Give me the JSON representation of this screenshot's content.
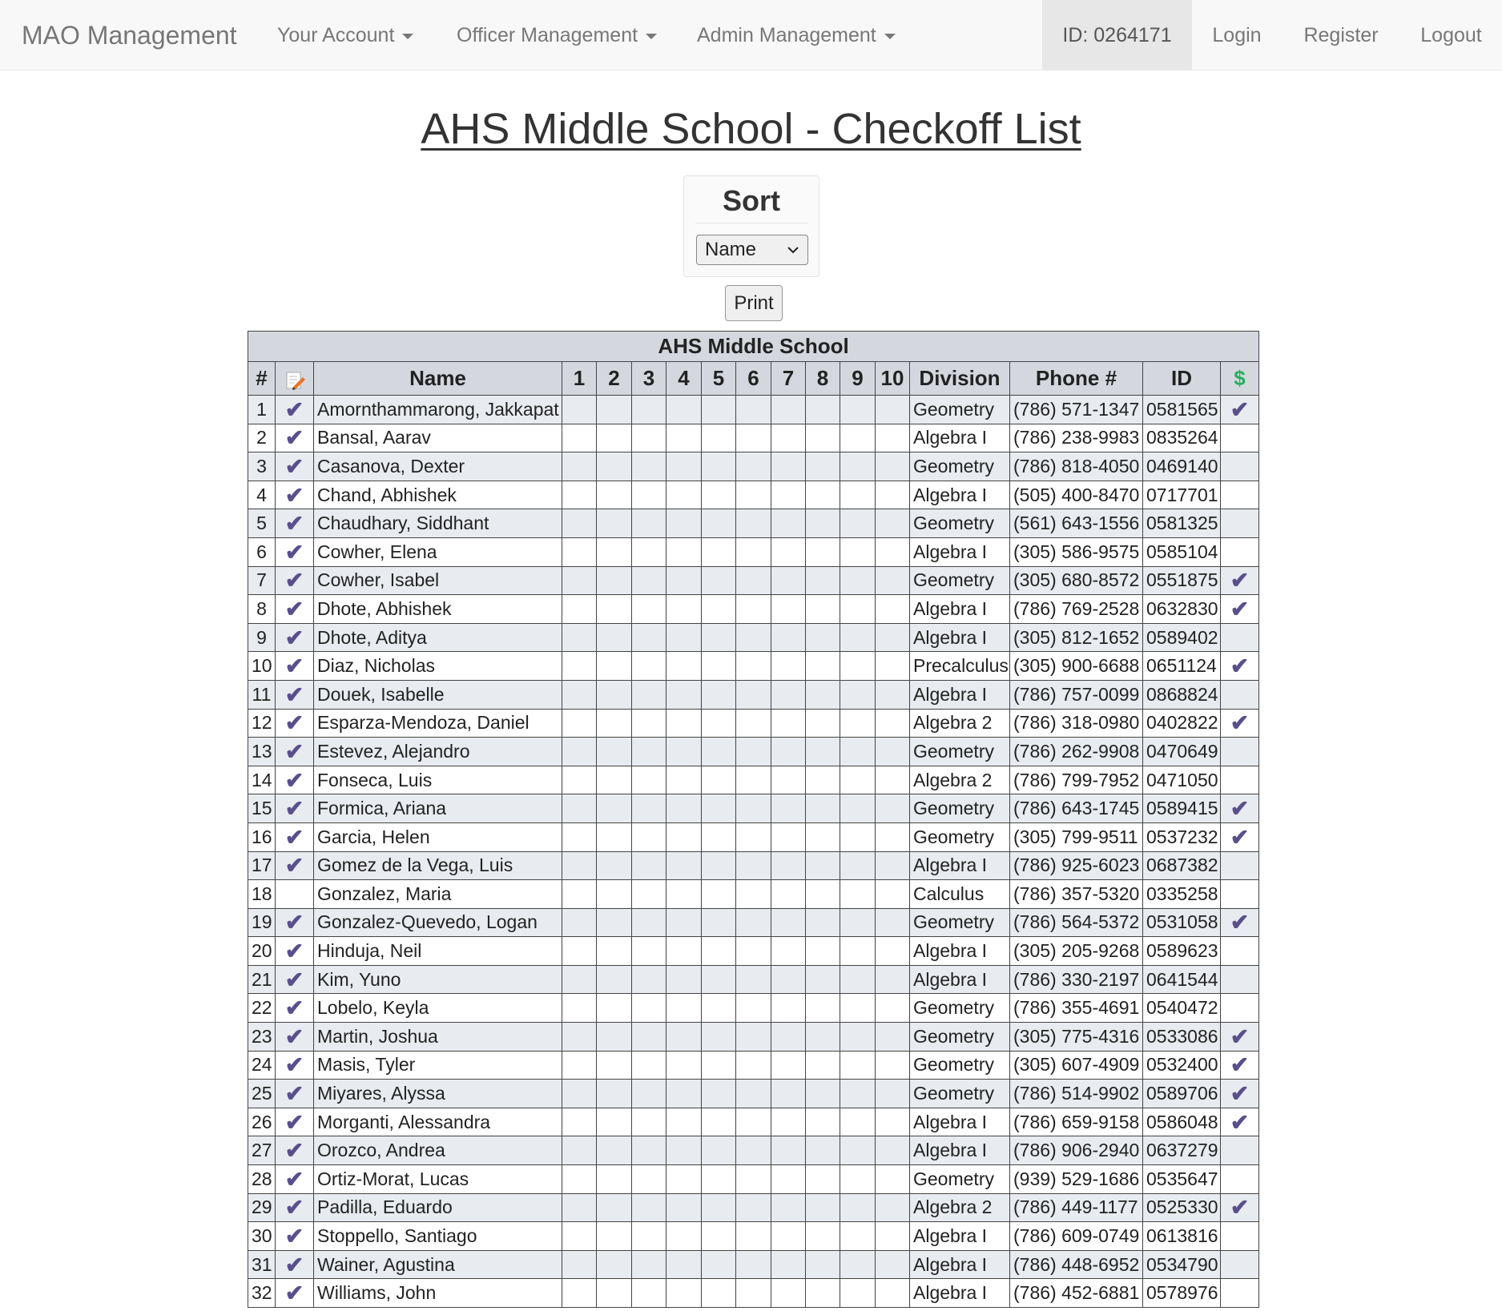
{
  "navbar": {
    "brand": "MAO Management",
    "menus": [
      "Your Account",
      "Officer Management",
      "Admin Management"
    ],
    "user_id": "ID: 0264171",
    "login": "Login",
    "register": "Register",
    "logout": "Logout"
  },
  "page": {
    "title": "AHS Middle School - Checkoff List"
  },
  "sort": {
    "title": "Sort",
    "selected": "Name"
  },
  "print_label": "Print",
  "table": {
    "caption": "AHS Middle School",
    "headers": [
      "#",
      "",
      "Name",
      "1",
      "2",
      "3",
      "4",
      "5",
      "6",
      "7",
      "8",
      "9",
      "10",
      "Division",
      "Phone #",
      "ID",
      "$"
    ],
    "checkmark": "✔",
    "rows": [
      {
        "num": "1",
        "checked": true,
        "name": "Amornthammarong, Jakkapat",
        "division": "Geometry",
        "phone": "(786) 571-1347",
        "id": "0581565",
        "paid": true
      },
      {
        "num": "2",
        "checked": true,
        "name": "Bansal, Aarav",
        "division": "Algebra I",
        "phone": "(786) 238-9983",
        "id": "0835264",
        "paid": false
      },
      {
        "num": "3",
        "checked": true,
        "name": "Casanova, Dexter",
        "division": "Geometry",
        "phone": "(786) 818-4050",
        "id": "0469140",
        "paid": false
      },
      {
        "num": "4",
        "checked": true,
        "name": "Chand, Abhishek",
        "division": "Algebra I",
        "phone": "(505) 400-8470",
        "id": "0717701",
        "paid": false
      },
      {
        "num": "5",
        "checked": true,
        "name": "Chaudhary, Siddhant",
        "division": "Geometry",
        "phone": "(561) 643-1556",
        "id": "0581325",
        "paid": false
      },
      {
        "num": "6",
        "checked": true,
        "name": "Cowher, Elena",
        "division": "Algebra I",
        "phone": "(305) 586-9575",
        "id": "0585104",
        "paid": false
      },
      {
        "num": "7",
        "checked": true,
        "name": "Cowher, Isabel",
        "division": "Geometry",
        "phone": "(305) 680-8572",
        "id": "0551875",
        "paid": true
      },
      {
        "num": "8",
        "checked": true,
        "name": "Dhote, Abhishek",
        "division": "Algebra I",
        "phone": "(786) 769-2528",
        "id": "0632830",
        "paid": true
      },
      {
        "num": "9",
        "checked": true,
        "name": "Dhote, Aditya",
        "division": "Algebra I",
        "phone": "(305) 812-1652",
        "id": "0589402",
        "paid": false
      },
      {
        "num": "10",
        "checked": true,
        "name": "Diaz, Nicholas",
        "division": "Precalculus",
        "phone": "(305) 900-6688",
        "id": "0651124",
        "paid": true
      },
      {
        "num": "11",
        "checked": true,
        "name": "Douek, Isabelle",
        "division": "Algebra I",
        "phone": "(786) 757-0099",
        "id": "0868824",
        "paid": false
      },
      {
        "num": "12",
        "checked": true,
        "name": "Esparza-Mendoza, Daniel",
        "division": "Algebra 2",
        "phone": "(786) 318-0980",
        "id": "0402822",
        "paid": true
      },
      {
        "num": "13",
        "checked": true,
        "name": "Estevez, Alejandro",
        "division": "Geometry",
        "phone": "(786) 262-9908",
        "id": "0470649",
        "paid": false
      },
      {
        "num": "14",
        "checked": true,
        "name": "Fonseca, Luis",
        "division": "Algebra 2",
        "phone": "(786) 799-7952",
        "id": "0471050",
        "paid": false
      },
      {
        "num": "15",
        "checked": true,
        "name": "Formica, Ariana",
        "division": "Geometry",
        "phone": "(786) 643-1745",
        "id": "0589415",
        "paid": true
      },
      {
        "num": "16",
        "checked": true,
        "name": "Garcia, Helen",
        "division": "Geometry",
        "phone": "(305) 799-9511",
        "id": "0537232",
        "paid": true
      },
      {
        "num": "17",
        "checked": true,
        "name": "Gomez de la Vega, Luis",
        "division": "Algebra I",
        "phone": "(786) 925-6023",
        "id": "0687382",
        "paid": false
      },
      {
        "num": "18",
        "checked": false,
        "name": "Gonzalez, Maria",
        "division": "Calculus",
        "phone": "(786) 357-5320",
        "id": "0335258",
        "paid": false
      },
      {
        "num": "19",
        "checked": true,
        "name": "Gonzalez-Quevedo, Logan",
        "division": "Geometry",
        "phone": "(786) 564-5372",
        "id": "0531058",
        "paid": true
      },
      {
        "num": "20",
        "checked": true,
        "name": "Hinduja, Neil",
        "division": "Algebra I",
        "phone": "(305) 205-9268",
        "id": "0589623",
        "paid": false
      },
      {
        "num": "21",
        "checked": true,
        "name": "Kim, Yuno",
        "division": "Algebra I",
        "phone": "(786) 330-2197",
        "id": "0641544",
        "paid": false
      },
      {
        "num": "22",
        "checked": true,
        "name": "Lobelo, Keyla",
        "division": "Geometry",
        "phone": "(786) 355-4691",
        "id": "0540472",
        "paid": false
      },
      {
        "num": "23",
        "checked": true,
        "name": "Martin, Joshua",
        "division": "Geometry",
        "phone": "(305) 775-4316",
        "id": "0533086",
        "paid": true
      },
      {
        "num": "24",
        "checked": true,
        "name": "Masis, Tyler",
        "division": "Geometry",
        "phone": "(305) 607-4909",
        "id": "0532400",
        "paid": true
      },
      {
        "num": "25",
        "checked": true,
        "name": "Miyares, Alyssa",
        "division": "Geometry",
        "phone": "(786) 514-9902",
        "id": "0589706",
        "paid": true
      },
      {
        "num": "26",
        "checked": true,
        "name": "Morganti, Alessandra",
        "division": "Algebra I",
        "phone": "(786) 659-9158",
        "id": "0586048",
        "paid": true
      },
      {
        "num": "27",
        "checked": true,
        "name": "Orozco, Andrea",
        "division": "Algebra I",
        "phone": "(786) 906-2940",
        "id": "0637279",
        "paid": false
      },
      {
        "num": "28",
        "checked": true,
        "name": "Ortiz-Morat, Lucas",
        "division": "Geometry",
        "phone": "(939) 529-1686",
        "id": "0535647",
        "paid": false
      },
      {
        "num": "29",
        "checked": true,
        "name": "Padilla, Eduardo",
        "division": "Algebra 2",
        "phone": "(786) 449-1177",
        "id": "0525330",
        "paid": true
      },
      {
        "num": "30",
        "checked": true,
        "name": "Stoppello, Santiago",
        "division": "Algebra I",
        "phone": "(786) 609-0749",
        "id": "0613816",
        "paid": false
      },
      {
        "num": "31",
        "checked": true,
        "name": "Wainer, Agustina",
        "division": "Algebra I",
        "phone": "(786) 448-6952",
        "id": "0534790",
        "paid": false
      },
      {
        "num": "32",
        "checked": true,
        "name": "Williams, John",
        "division": "Algebra I",
        "phone": "(786) 452-6881",
        "id": "0578976",
        "paid": false
      }
    ]
  },
  "colors": {
    "checkmark": "#5a4f8c",
    "dollar": "#27ae60",
    "header_bg": "#d4d8de",
    "stripe_bg": "#e8ebef"
  },
  "icons": {
    "edit_column": "pencil-paper-icon",
    "paid_column": "dollar-icon",
    "row_check": "checkmark-icon"
  }
}
